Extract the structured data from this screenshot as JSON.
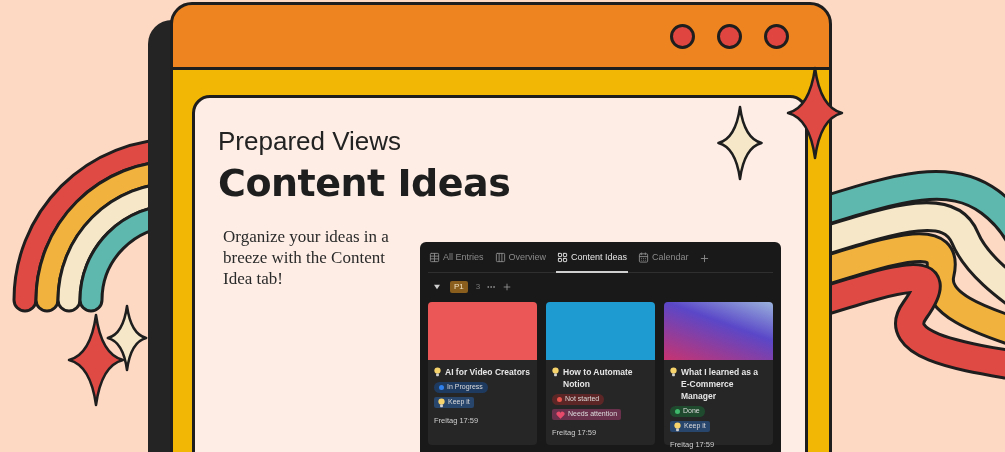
{
  "hero": {
    "eyebrow": "Prepared Views",
    "title": "Content Ideas",
    "description": "Organize your ideas in a breeze with the Content Idea tab!"
  },
  "notion": {
    "tabs": [
      {
        "label": "All Entries",
        "kind": "table",
        "selected": false
      },
      {
        "label": "Overview",
        "kind": "board",
        "selected": false
      },
      {
        "label": "Content Ideas",
        "kind": "gallery",
        "selected": true
      },
      {
        "label": "Calendar",
        "kind": "calendar",
        "selected": false
      }
    ],
    "group": {
      "label": "P1",
      "count": "3",
      "expanded": true
    },
    "cards": [
      {
        "cover": {
          "kind": "solid",
          "color": "#eb5757"
        },
        "title": "AI for Video Creators",
        "status": {
          "label": "In Progress",
          "color": "#2f80ed"
        },
        "tags": [
          {
            "label": "Keep it",
            "kind": "bulb",
            "color": "#28456c"
          }
        ],
        "date": "Freitag 17:59"
      },
      {
        "cover": {
          "kind": "solid",
          "color": "#1e9bd0"
        },
        "title": "How to Automate Notion",
        "status": {
          "label": "Not started",
          "color": "#e5534b"
        },
        "tags": [
          {
            "label": "Needs attention",
            "kind": "heart",
            "color": "#69314c"
          }
        ],
        "date": "Freitag 17:59"
      },
      {
        "cover": {
          "kind": "gradient",
          "color": "#5a47c8"
        },
        "title": "What I learned as a E-Commerce Manager",
        "status": {
          "label": "Done",
          "color": "#3fb96b"
        },
        "tags": [
          {
            "label": "Keep it",
            "kind": "bulb",
            "color": "#28456c"
          }
        ],
        "date": "Freitag 17:59"
      }
    ]
  }
}
